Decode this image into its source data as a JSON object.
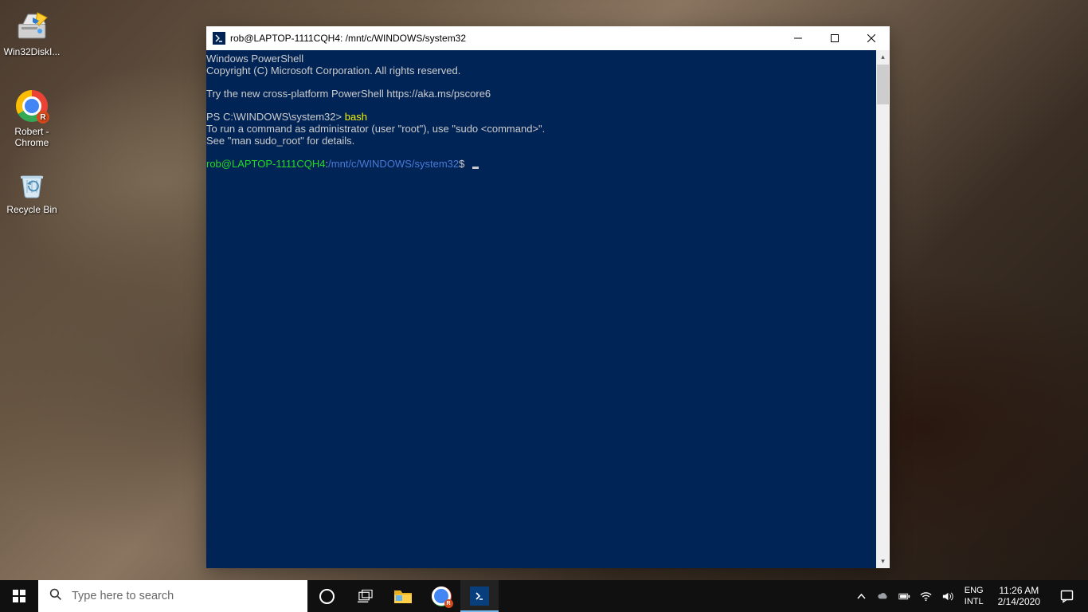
{
  "desktop_icons": [
    {
      "name": "win32diskimager-icon",
      "label": "Win32DiskI..."
    },
    {
      "name": "chrome-profile-icon",
      "label": "Robert - Chrome"
    },
    {
      "name": "recycle-bin-icon",
      "label": "Recycle Bin"
    }
  ],
  "terminal": {
    "title": "rob@LAPTOP-1111CQH4: /mnt/c/WINDOWS/system32",
    "lines": {
      "l1": "Windows PowerShell",
      "l2": "Copyright (C) Microsoft Corporation. All rights reserved.",
      "l3": "Try the new cross-platform PowerShell https://aka.ms/pscore6",
      "l4_prompt": "PS C:\\WINDOWS\\system32> ",
      "l4_cmd": "bash",
      "l5": "To run a command as administrator (user \"root\"), use \"sudo <command>\".",
      "l6": "See \"man sudo_root\" for details.",
      "l7_user": "rob@LAPTOP-1111CQH4",
      "l7_colon": ":",
      "l7_path": "/mnt/c/WINDOWS/system32",
      "l7_dollar": "$"
    }
  },
  "taskbar": {
    "search_placeholder": "Type here to search",
    "lang_top": "ENG",
    "lang_bottom": "INTL",
    "time": "11:26 AM",
    "date": "2/14/2020"
  }
}
